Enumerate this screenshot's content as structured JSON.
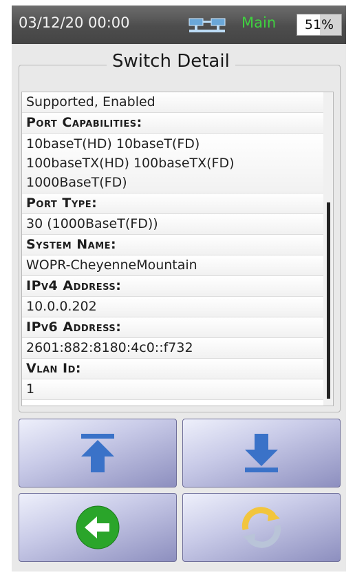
{
  "status_bar": {
    "datetime": "03/12/20 00:00",
    "mode": "Main",
    "battery_label": "51%",
    "battery_level": 0.51
  },
  "panel": {
    "title": "Switch Detail"
  },
  "rows": [
    {
      "type": "value",
      "text": "Supported, Enabled"
    },
    {
      "type": "label",
      "text": "Port Capabilities:"
    },
    {
      "type": "value-multi",
      "lines": [
        "10baseT(HD) 10baseT(FD)",
        "100baseTX(HD) 100baseTX(FD)",
        "1000BaseT(FD)"
      ]
    },
    {
      "type": "label",
      "text": "Port Type:"
    },
    {
      "type": "value",
      "text": "30 (1000BaseT(FD))"
    },
    {
      "type": "label",
      "text": "System Name:"
    },
    {
      "type": "value",
      "text": "WOPR-CheyenneMountain"
    },
    {
      "type": "label",
      "text": "IPv4 Address:"
    },
    {
      "type": "value",
      "text": "10.0.0.202"
    },
    {
      "type": "label",
      "text": "IPv6 Address:"
    },
    {
      "type": "value",
      "text": "2601:882:8180:4c0::f732"
    },
    {
      "type": "label",
      "text": "Vlan Id:"
    },
    {
      "type": "value",
      "text": "1"
    }
  ],
  "buttons": {
    "scroll_top_icon": "arrow-up-to-bar-icon",
    "scroll_bottom_icon": "arrow-down-to-bar-icon",
    "back_icon": "green-back-arrow-icon",
    "refresh_icon": "refresh-cycle-icon"
  },
  "colors": {
    "status_bar": "#4d4d4d",
    "main_mode": "#3fd23f",
    "button_blue": "#3a72c8",
    "back_green": "#2aa52a",
    "refresh_yellow": "#f2c53d"
  }
}
